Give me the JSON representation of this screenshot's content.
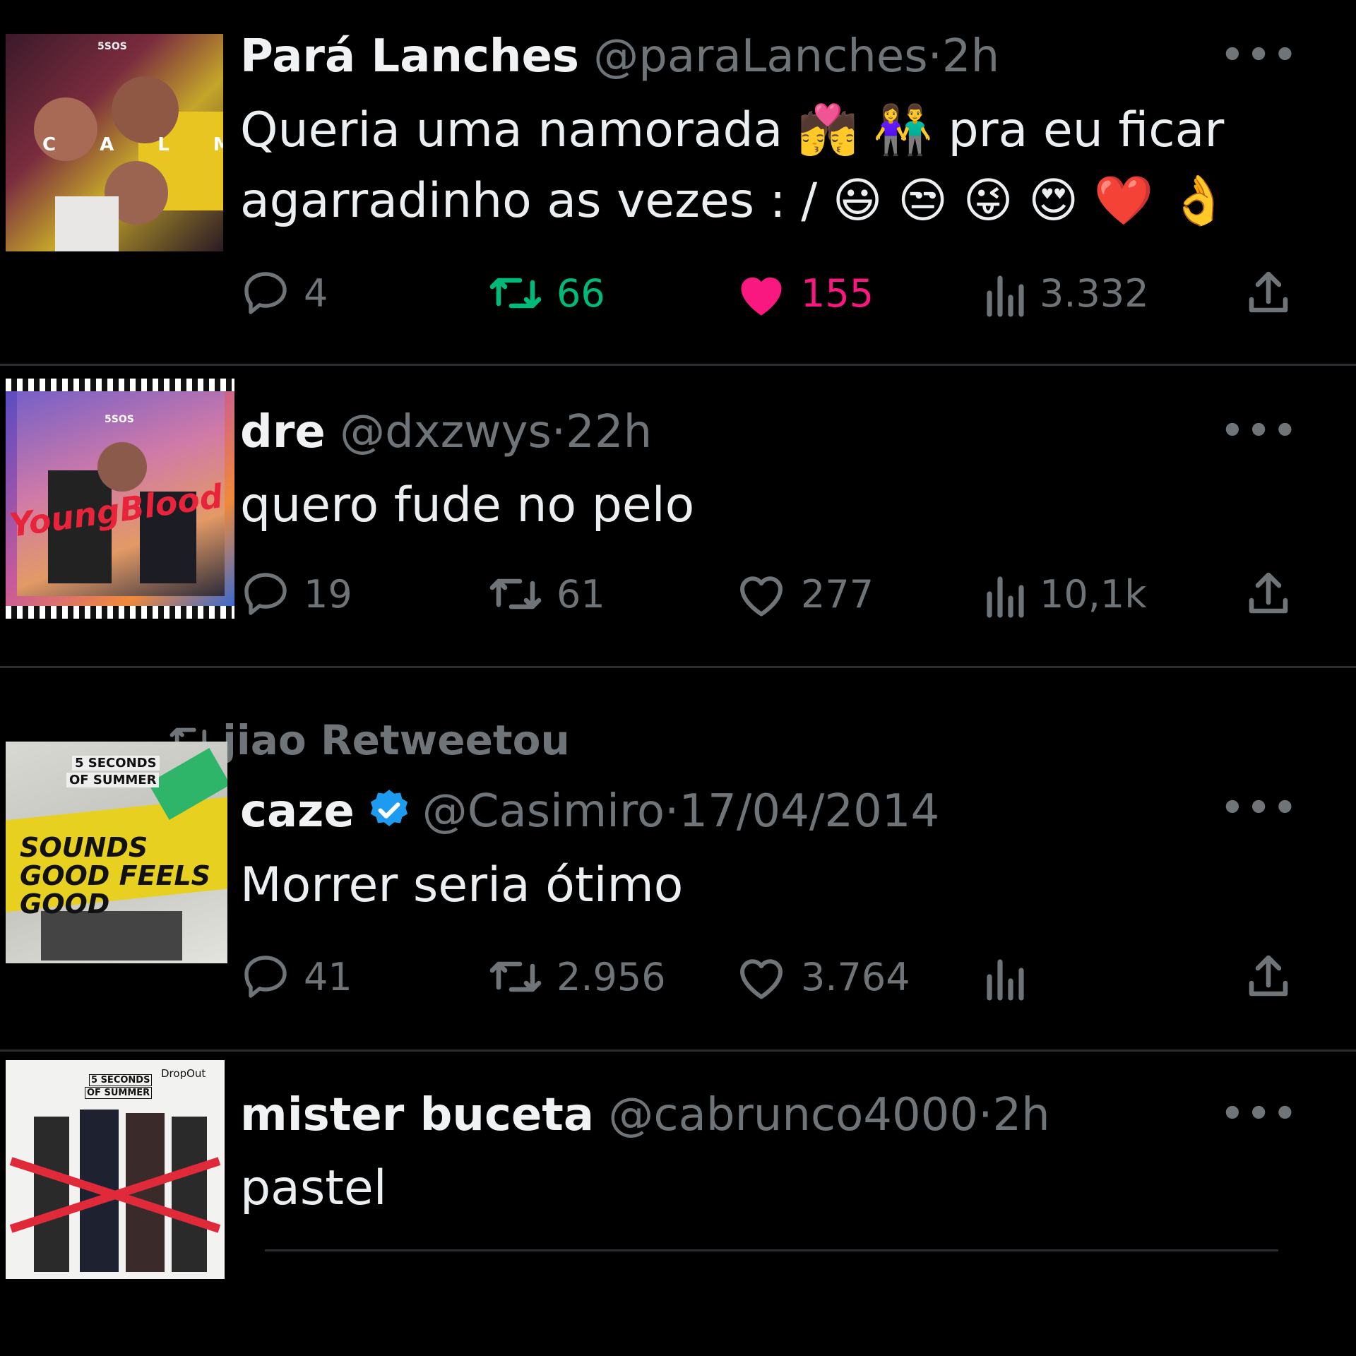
{
  "colors": {
    "background": "#000000",
    "text": "#e7e9ea",
    "muted": "#6f7479",
    "retweet_active": "#00ba7c",
    "like_active": "#f91880",
    "verified": "#1d9bf0"
  },
  "tweets": [
    {
      "author_name": "Pará Lanches",
      "handle": "@paraLanches",
      "separator": "·",
      "time": "2h",
      "text_line1": "Queria uma namorada 💏 👫 pra eu ficar",
      "text_line2": "agarradinho as vezes : / 😃 😒 😜 😍 ❤️ 👌",
      "avatar_text": "5SOS",
      "avatar_word": "CALM",
      "replies": "4",
      "retweets": "66",
      "likes": "155",
      "views": "3.332",
      "retweeted_state": true,
      "liked_state": true
    },
    {
      "author_name": "dre",
      "handle": "@dxzwys",
      "separator": "·",
      "time": "22h",
      "text_line1": "quero fude no pelo",
      "avatar_text": "5SOS",
      "avatar_word": "YoungBlood",
      "replies": "19",
      "retweets": "61",
      "likes": "277",
      "views": "10,1k"
    },
    {
      "retweeted_by": "jiao Retweetou",
      "author_name": "caze",
      "verified": true,
      "handle": "@Casimiro",
      "separator": "·",
      "time": "17/04/2014",
      "text_line1": "Morrer seria ótimo",
      "avatar_text_line1": "5 SECONDS",
      "avatar_text_line2": "OF SUMMER",
      "avatar_word": "SOUNDS GOOD FEELS GOOD",
      "replies": "41",
      "retweets": "2.956",
      "likes": "3.764",
      "views": ""
    },
    {
      "author_name": "mister buceta",
      "handle": "@cabrunco4000",
      "separator": "·",
      "time": "2h",
      "text_line1": "pastel",
      "avatar_text_line1": "5 SECONDS",
      "avatar_text_line2": "OF SUMMER",
      "avatar_word": "DropOut"
    }
  ]
}
